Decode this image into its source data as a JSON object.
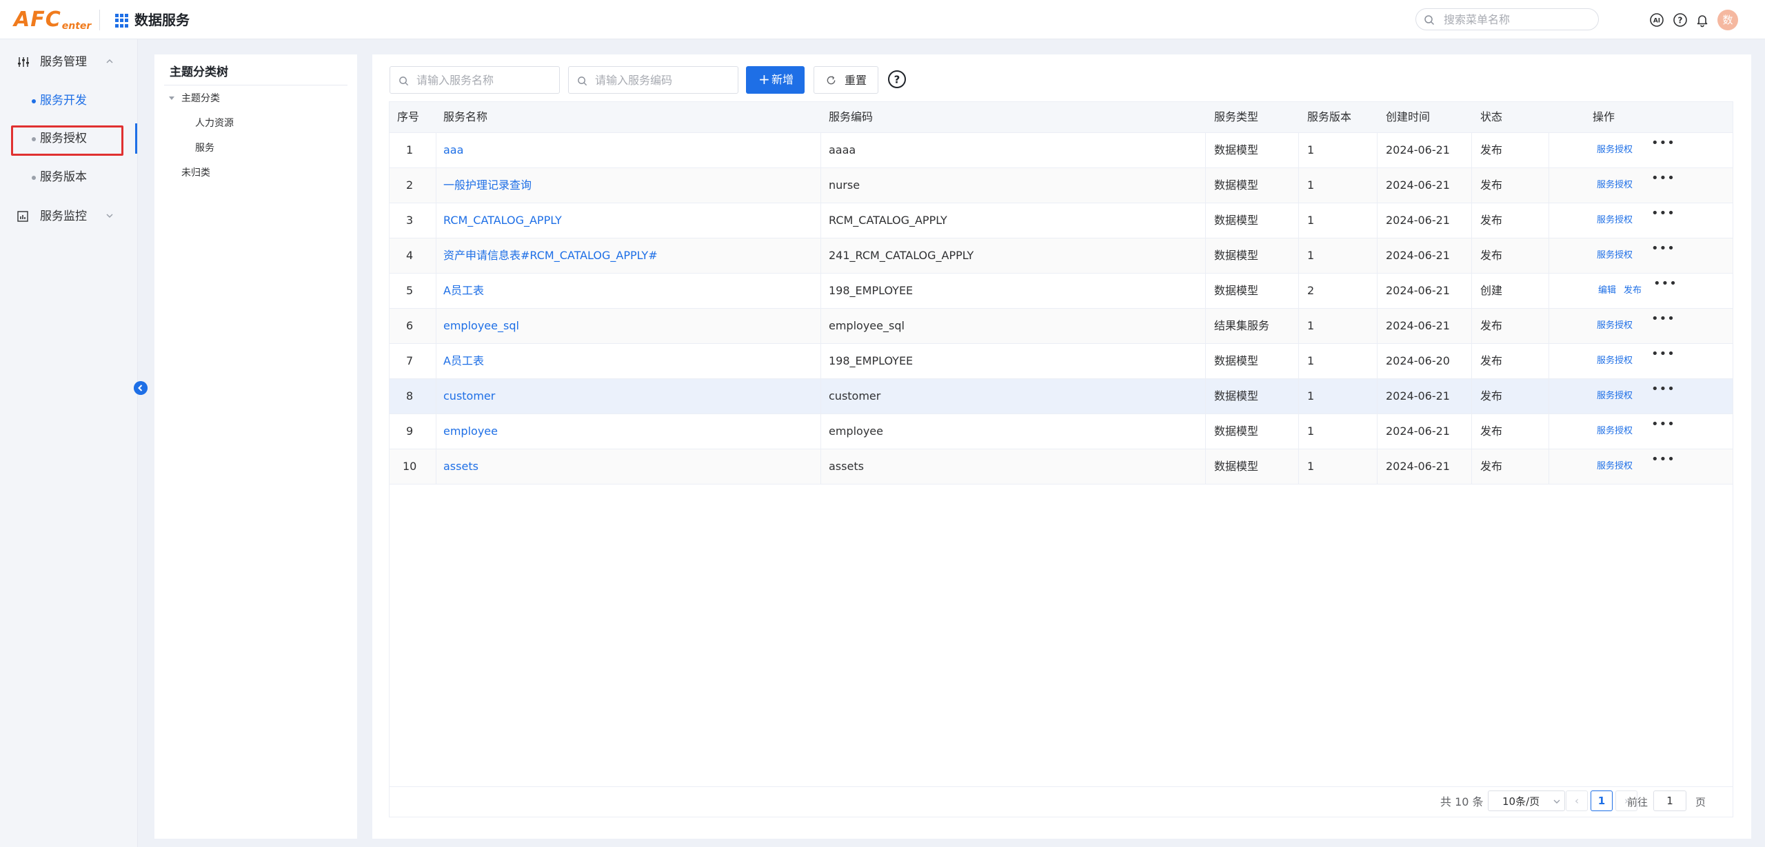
{
  "header": {
    "logo_main": "AFC",
    "logo_sub": "enter",
    "app_title": "数据服务",
    "search_placeholder": "搜索菜单名称",
    "avatar_text": "数",
    "icons": [
      "ai-icon",
      "help-icon",
      "bell-icon"
    ]
  },
  "sidebar": {
    "groups": [
      {
        "label": "服务管理",
        "icon": "sliders-icon",
        "expanded": true
      },
      {
        "label": "服务监控",
        "icon": "chart-icon",
        "expanded": false
      }
    ],
    "items": [
      {
        "label": "服务开发",
        "active": true
      },
      {
        "label": "服务授权",
        "active": false
      },
      {
        "label": "服务版本",
        "active": false
      }
    ]
  },
  "tree": {
    "title": "主题分类树",
    "nodes": [
      {
        "label": "主题分类",
        "level": 0,
        "expanded": true
      },
      {
        "label": "人力资源",
        "level": 1
      },
      {
        "label": "服务",
        "level": 1
      },
      {
        "label": "未归类",
        "level": 0
      }
    ]
  },
  "toolbar": {
    "name_placeholder": "请输入服务名称",
    "code_placeholder": "请输入服务编码",
    "add_label": "新增",
    "reset_label": "重置"
  },
  "table": {
    "columns": [
      "序号",
      "服务名称",
      "服务编码",
      "服务类型",
      "服务版本",
      "创建时间",
      "状态",
      "操作"
    ],
    "rows": [
      {
        "no": "1",
        "name": "aaa",
        "code": "aaaa",
        "type": "数据模型",
        "version": "1",
        "created": "2024-06-21",
        "status": "发布",
        "ops": [
          "服务授权"
        ]
      },
      {
        "no": "2",
        "name": "一般护理记录查询",
        "code": "nurse",
        "type": "数据模型",
        "version": "1",
        "created": "2024-06-21",
        "status": "发布",
        "ops": [
          "服务授权"
        ]
      },
      {
        "no": "3",
        "name": "RCM_CATALOG_APPLY",
        "code": "RCM_CATALOG_APPLY",
        "type": "数据模型",
        "version": "1",
        "created": "2024-06-21",
        "status": "发布",
        "ops": [
          "服务授权"
        ]
      },
      {
        "no": "4",
        "name": "资产申请信息表#RCM_CATALOG_APPLY#",
        "code": "241_RCM_CATALOG_APPLY",
        "type": "数据模型",
        "version": "1",
        "created": "2024-06-21",
        "status": "发布",
        "ops": [
          "服务授权"
        ]
      },
      {
        "no": "5",
        "name": "A员工表",
        "code": "198_EMPLOYEE",
        "type": "数据模型",
        "version": "2",
        "created": "2024-06-21",
        "status": "创建",
        "ops": [
          "编辑",
          "发布"
        ]
      },
      {
        "no": "6",
        "name": "employee_sql",
        "code": "employee_sql",
        "type": "结果集服务",
        "version": "1",
        "created": "2024-06-21",
        "status": "发布",
        "ops": [
          "服务授权"
        ]
      },
      {
        "no": "7",
        "name": "A员工表",
        "code": "198_EMPLOYEE",
        "type": "数据模型",
        "version": "1",
        "created": "2024-06-20",
        "status": "发布",
        "ops": [
          "服务授权"
        ]
      },
      {
        "no": "8",
        "name": "customer",
        "code": "customer",
        "type": "数据模型",
        "version": "1",
        "created": "2024-06-21",
        "status": "发布",
        "ops": [
          "服务授权"
        ]
      },
      {
        "no": "9",
        "name": "employee",
        "code": "employee",
        "type": "数据模型",
        "version": "1",
        "created": "2024-06-21",
        "status": "发布",
        "ops": [
          "服务授权"
        ]
      },
      {
        "no": "10",
        "name": "assets",
        "code": "assets",
        "type": "数据模型",
        "version": "1",
        "created": "2024-06-21",
        "status": "发布",
        "ops": [
          "服务授权"
        ]
      }
    ],
    "more_label": "•••"
  },
  "pagination": {
    "total": "共 10 条",
    "page_size": "10条/页",
    "current_page": "1",
    "goto_prefix": "前往",
    "goto_value": "1",
    "goto_suffix": "页"
  },
  "colors": {
    "accent": "#1e6fe6",
    "logo": "#f07b1d",
    "highlight": "#e03131"
  }
}
